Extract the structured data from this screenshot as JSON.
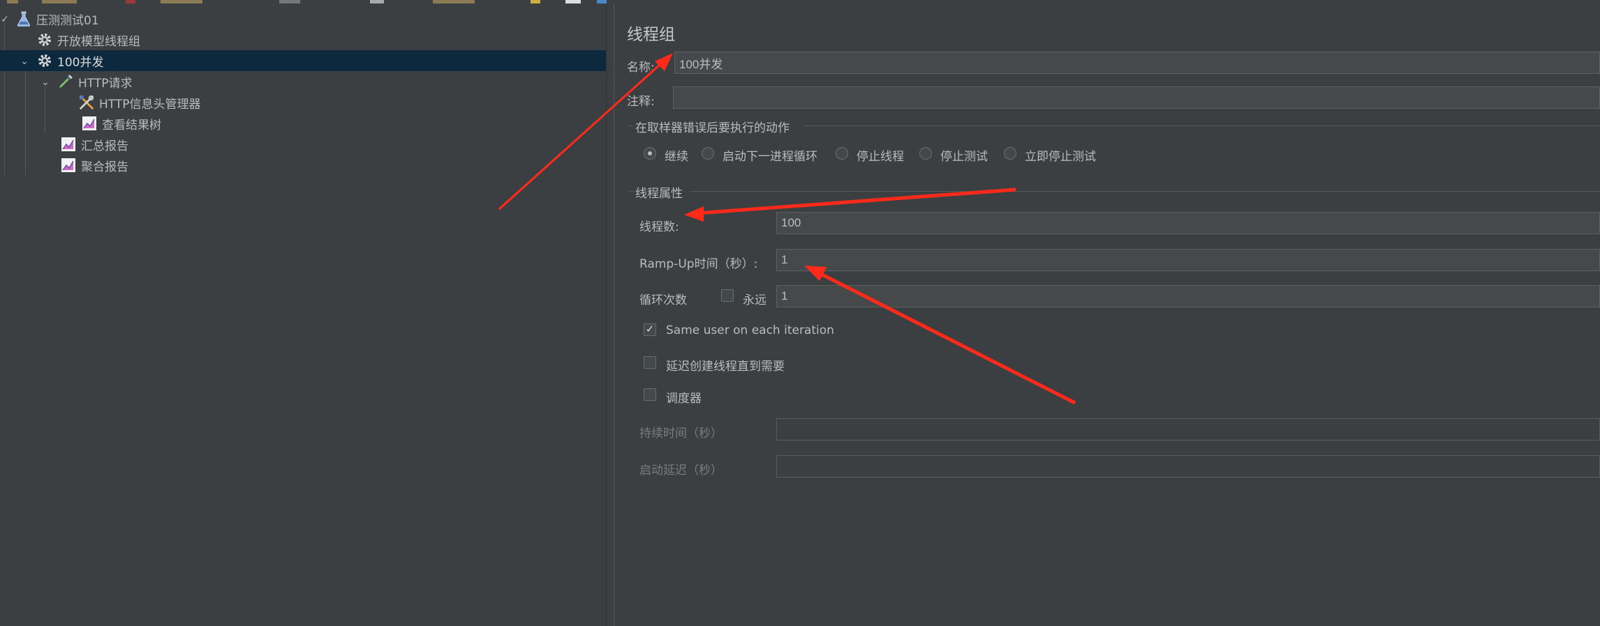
{
  "tree": {
    "items": [
      {
        "label": "压测测试01",
        "icon": "test-plan-flask-icon"
      },
      {
        "label": "开放模型线程组",
        "icon": "gear-icon"
      },
      {
        "label": "100并发",
        "icon": "gear-icon"
      },
      {
        "label": "HTTP请求",
        "icon": "pipette-sampler-icon"
      },
      {
        "label": "HTTP信息头管理器",
        "icon": "tools-config-icon"
      },
      {
        "label": "查看结果树",
        "icon": "listener-chart-icon"
      },
      {
        "label": "汇总报告",
        "icon": "listener-chart-icon"
      },
      {
        "label": "聚合报告",
        "icon": "listener-chart-icon"
      }
    ]
  },
  "panel": {
    "title": "线程组",
    "name_label": "名称:",
    "name_value": "100并发",
    "comment_label": "注释:",
    "comment_value": "",
    "action_group_label": "在取样器错误后要执行的动作",
    "actions": [
      {
        "label": "继续",
        "selected": true
      },
      {
        "label": "启动下一进程循环",
        "selected": false
      },
      {
        "label": "停止线程",
        "selected": false
      },
      {
        "label": "停止测试",
        "selected": false
      },
      {
        "label": "立即停止测试",
        "selected": false
      }
    ],
    "thread_props_label": "线程属性",
    "threads_label": "线程数:",
    "threads_value": "100",
    "rampup_label": "Ramp-Up时间（秒）:",
    "rampup_value": "1",
    "loop_label": "循环次数",
    "forever_label": "永远",
    "forever_checked": false,
    "loop_value": "1",
    "same_user_label": "Same user on each iteration",
    "same_user_checked": true,
    "delay_label": "延迟创建线程直到需要",
    "delay_checked": false,
    "scheduler_label": "调度器",
    "scheduler_checked": false,
    "duration_label": "持续时间（秒）",
    "duration_value": "",
    "startup_delay_label": "启动延迟（秒）",
    "startup_delay_value": ""
  },
  "colors": {
    "background": "#3c3f41",
    "selection": "#0d293e",
    "annotation_arrow": "#ff2a1a"
  }
}
